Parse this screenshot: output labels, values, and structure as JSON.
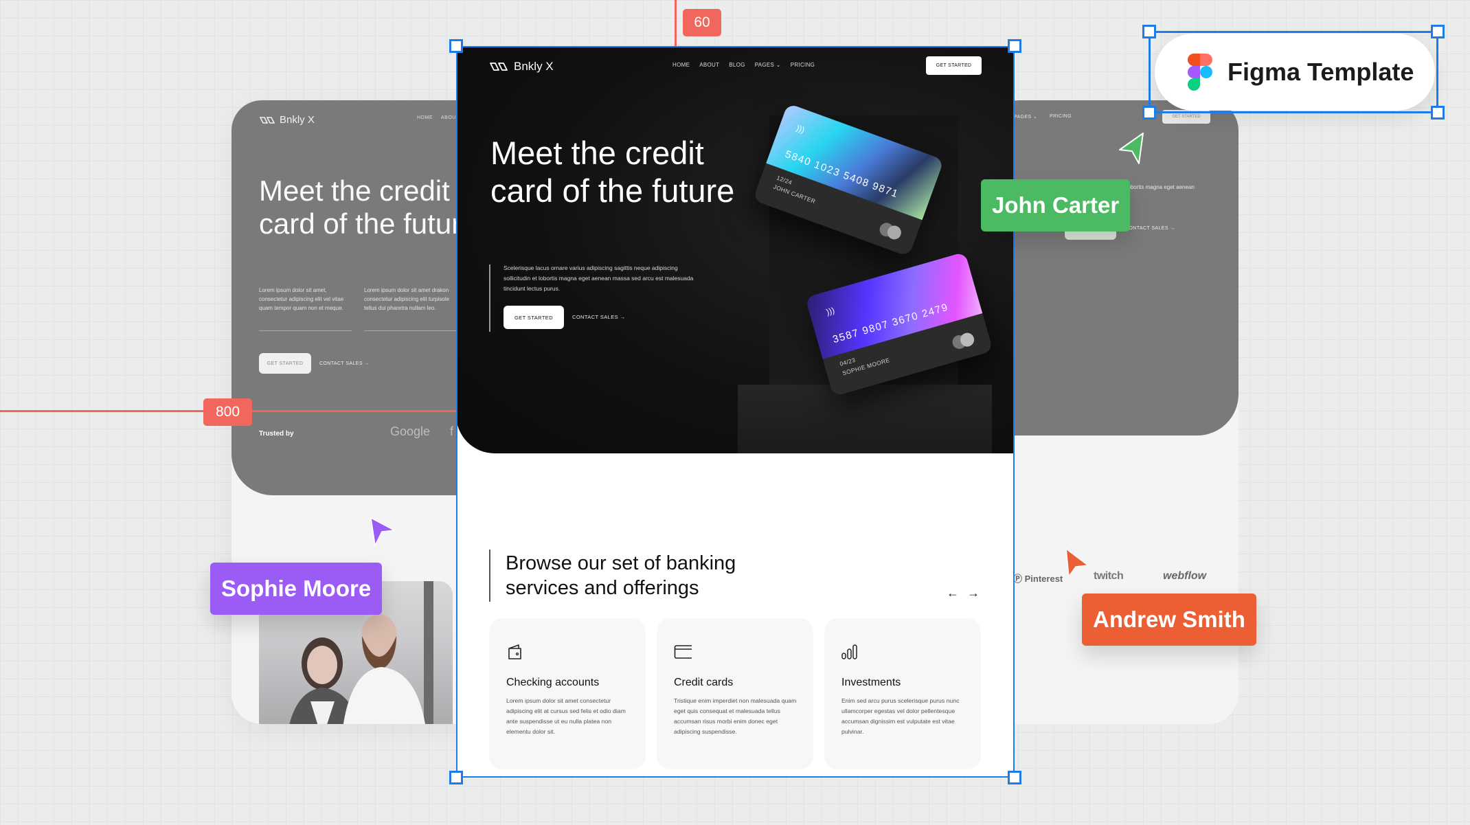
{
  "canvas": {
    "measurements": {
      "top": "60",
      "left": "800"
    },
    "badge": {
      "label": "Figma Template",
      "icon": "figma-logo-icon"
    },
    "collaborators": [
      {
        "name": "John Carter",
        "color": "#4cb963"
      },
      {
        "name": "Sophie Moore",
        "color": "#9b5cf6"
      },
      {
        "name": "Andrew Smith",
        "color": "#ec5f35"
      }
    ]
  },
  "left_page": {
    "logo": "Bnkly X",
    "nav": [
      "HOME",
      "ABOU"
    ],
    "title": "Meet the credit card of the future",
    "para1": "Lorem ipsum dolor sit amet, consectetur adipiscing elit vel vitae quam tempor quam non et meque.",
    "para2": "Lorem ipsum dolor sit amet drakon consectetur adipiscing elit turpisole tellus dui pharetra nullam leo.",
    "cta_primary": "GET STARTED",
    "cta_secondary": "CONTACT SALES",
    "trusted_by": "Trusted by",
    "logos": [
      "Google",
      "f"
    ]
  },
  "right_page": {
    "nav": [
      "PAGES",
      "PRICING"
    ],
    "cta": "GET STARTED",
    "para": "e varius adipiscing sagittis neque lobortis magna eget aenean esuada tincidunt lectus purus.",
    "cta_secondary": "CONTACT SALES",
    "logos": [
      "Pinterest",
      "twitch",
      "webflow"
    ]
  },
  "main": {
    "logo": "Bnkly X",
    "nav": [
      {
        "label": "HOME"
      },
      {
        "label": "ABOUT"
      },
      {
        "label": "BLOG"
      },
      {
        "label": "PAGES",
        "dropdown": true
      },
      {
        "label": "PRICING"
      }
    ],
    "nav_cta": "GET STARTED",
    "hero": {
      "title": "Meet the credit card of the future",
      "paragraph": "Scelerisque lacus ornare varius adipiscing sagittis neque adipiscing sollicitudin et lobortis magna eget aenean massa sed arcu est malesuada tincidunt lectus purus.",
      "cta_primary": "GET STARTED",
      "cta_secondary": "CONTACT SALES"
    },
    "cards": [
      {
        "number": "5840 1023 5408 9871",
        "expiry": "12/24",
        "holder": "JOHN CARTER"
      },
      {
        "number": "3587 9807 3670 2479",
        "expiry": "04/23",
        "holder": "SOPHIE MOORE"
      }
    ],
    "services": {
      "title": "Browse our set of banking services and offerings",
      "items": [
        {
          "icon": "wallet-icon",
          "title": "Checking accounts",
          "desc": "Lorem ipsum dolor sit amet consectetur adipiscing elit at cursus sed felis et odio diam ante suspendisse ut eu nulla platea non elementu dolor sit."
        },
        {
          "icon": "credit-card-icon",
          "title": "Credit cards",
          "desc": "Tristique enim imperdiet non malesuada quam eget quis consequat et malesuada tellus accumsan risus morbi enim donec eget adipiscing suspendisse."
        },
        {
          "icon": "bar-chart-icon",
          "title": "Investments",
          "desc": "Enim sed arcu purus scelerisque purus nunc ullamcorper egestas vel dolor pellentesque accumsan dignissim est vulputate est vitae pulvinar."
        }
      ]
    }
  }
}
